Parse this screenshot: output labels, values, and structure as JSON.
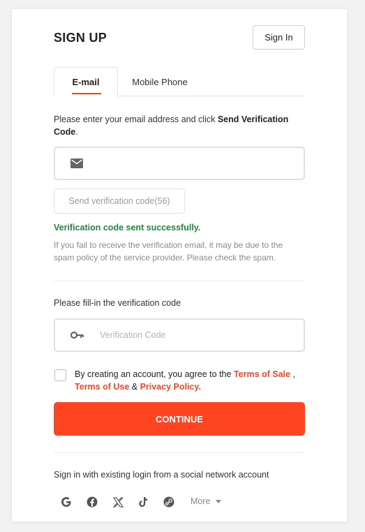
{
  "header": {
    "title": "SIGN UP",
    "signin_label": "Sign In"
  },
  "tabs": [
    {
      "label": "E-mail",
      "active": true
    },
    {
      "label": "Mobile Phone",
      "active": false
    }
  ],
  "instruction": {
    "prefix": "Please enter your email address and click ",
    "bold": "Send Verification Code",
    "suffix": "."
  },
  "email": {
    "value": "",
    "placeholder": "",
    "icon": "mail-icon"
  },
  "send_code": {
    "label": "Send verification code(56)"
  },
  "success_message": "Verification code sent successfully.",
  "spam_hint": "If you fail to receive the verification email, it may be due to the spam policy of the service provider. Please check the spam.",
  "verification": {
    "label": "Please fill-in the verification code",
    "placeholder": "Verification Code",
    "value": "",
    "icon": "key-icon"
  },
  "agreement": {
    "prefix": "By creating an account, you agree to the ",
    "terms_of_sale": "Terms of Sale",
    "comma": " ,",
    "terms_of_use": "Terms of Use",
    "amp": " & ",
    "privacy_policy": "Privacy Policy",
    "period": ".",
    "checked": false
  },
  "continue_label": "CONTINUE",
  "social": {
    "label": "Sign in with existing login from a social network account",
    "providers": [
      "google-icon",
      "facebook-icon",
      "x-icon",
      "tiktok-icon",
      "steam-icon"
    ],
    "more_label": "More"
  },
  "colors": {
    "accent": "#ff4422",
    "success": "#1f8a3a",
    "hint": "#8a8a8a"
  }
}
